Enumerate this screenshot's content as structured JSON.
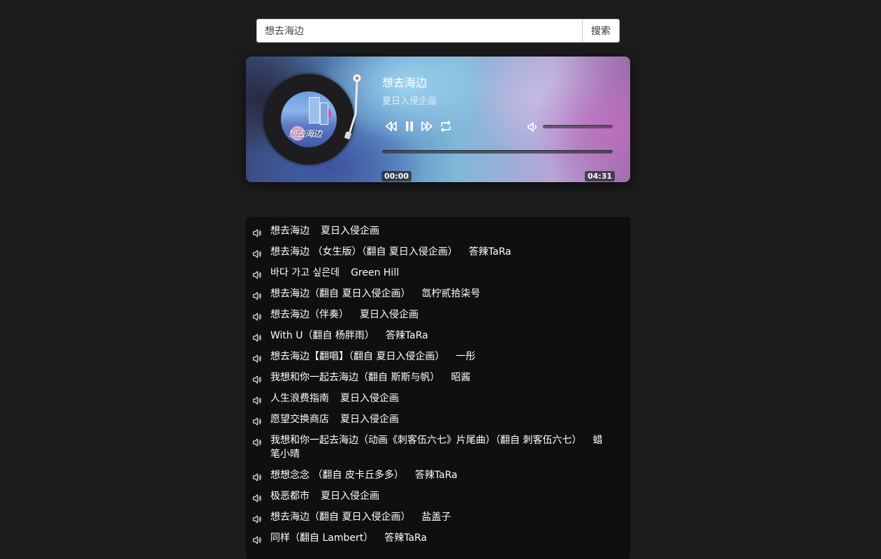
{
  "search": {
    "value": "想去海边",
    "button_label": "搜索"
  },
  "player": {
    "title": "想去海边",
    "artist": "夏日入侵企画",
    "current_time": "00:00",
    "total_time": "04:31",
    "progress": 0,
    "state": "playing",
    "album_lettering": "想去海边"
  },
  "icons": {
    "rewind": "rewind-icon",
    "pause": "pause-icon",
    "forward": "fast-forward-icon",
    "repeat": "repeat-icon",
    "volume": "volume-icon",
    "list_item": "speaker-icon"
  },
  "playlist": [
    {
      "song": "想去海边",
      "artist": "夏日入侵企画"
    },
    {
      "song": "想去海边 （女生版）（翻自 夏日入侵企画）",
      "artist": "答辣TaRa"
    },
    {
      "song": "바다 가고 싶은데",
      "artist": "Green Hill"
    },
    {
      "song": "想去海边（翻自 夏日入侵企画）",
      "artist": "氙柠贰拾柒号"
    },
    {
      "song": "想去海边（伴奏）",
      "artist": "夏日入侵企画"
    },
    {
      "song": "With U（翻自 杨胖雨）",
      "artist": "答辣TaRa"
    },
    {
      "song": "想去海边【翻唱】（翻自 夏日入侵企画）",
      "artist": "一彤"
    },
    {
      "song": "我想和你一起去海边（翻自 斯斯与帆）",
      "artist": "昭酱"
    },
    {
      "song": "人生浪费指南",
      "artist": "夏日入侵企画"
    },
    {
      "song": "愿望交换商店",
      "artist": "夏日入侵企画"
    },
    {
      "song": "我想和你一起去海边（动画《刺客伍六七》片尾曲）（翻自 刺客伍六七）",
      "artist": "蜡笔小晴"
    },
    {
      "song": "想想念念 （翻自 皮卡丘多多）",
      "artist": "答辣TaRa"
    },
    {
      "song": "极恶都市",
      "artist": "夏日入侵企画"
    },
    {
      "song": "想去海边（翻自 夏日入侵企画）",
      "artist": "盐盖子"
    },
    {
      "song": "同样（翻自 Lambert）",
      "artist": "答辣TaRa"
    }
  ]
}
